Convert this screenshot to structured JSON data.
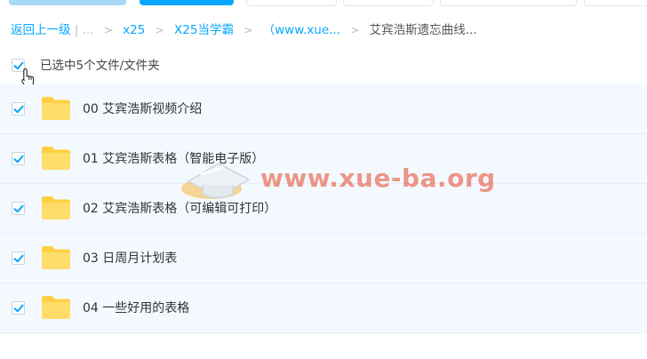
{
  "breadcrumb": {
    "back": "返回上一级",
    "divider": "|",
    "ellipsis": "...",
    "sep": ">",
    "items": [
      "x25",
      "X25当学霸",
      "（www.xue..."
    ],
    "current": "艾宾浩斯遗忘曲线..."
  },
  "selection": {
    "label": "已选中5个文件/文件夹",
    "checked": true
  },
  "files": [
    {
      "name": "00 艾宾浩斯视频介绍",
      "type": "folder",
      "checked": true
    },
    {
      "name": "01 艾宾浩斯表格（智能电子版）",
      "type": "folder",
      "checked": true
    },
    {
      "name": "02 艾宾浩斯表格（可编辑可打印）",
      "type": "folder",
      "checked": true
    },
    {
      "name": "03 日周月计划表",
      "type": "folder",
      "checked": true
    },
    {
      "name": "04 一些好用的表格",
      "type": "folder",
      "checked": true
    }
  ],
  "watermark": {
    "text": "www.xue-ba.org"
  },
  "colors": {
    "accent": "#06a7ff",
    "row_selected": "#f3f9fe",
    "folder": "#ffd043",
    "watermark": "#e8442a"
  },
  "icons": {
    "checkbox": "checkmark-icon",
    "folder": "folder-icon",
    "cursor": "hand-pointer-icon"
  }
}
